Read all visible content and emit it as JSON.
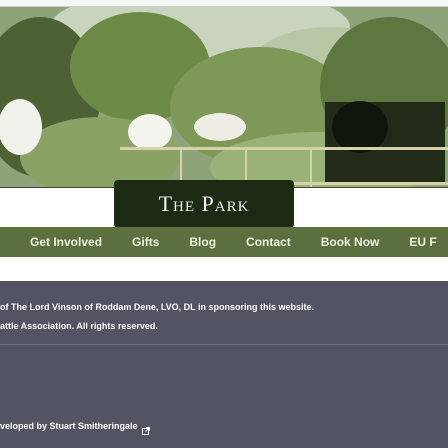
{
  "hero": {
    "title": "The Park"
  },
  "nav": {
    "items": [
      "Get Involved",
      "Gifts",
      "Blog",
      "Contact",
      "Book Now",
      "EU F"
    ]
  },
  "footer": {
    "sponsor_text": "of The Lord Vinson of Roddam Dene, LVO, DL in sponsoring this website.",
    "rights_text": "attle Association. All rights reserved.",
    "developer_text": "veloped by Stuart Smitheringale"
  },
  "colors": {
    "nav_bg": "#5b6f3f",
    "footer_bg": "#525463",
    "plaque_bg": "#1e2a14"
  },
  "icons": {
    "developer_link": "external-link-icon"
  }
}
